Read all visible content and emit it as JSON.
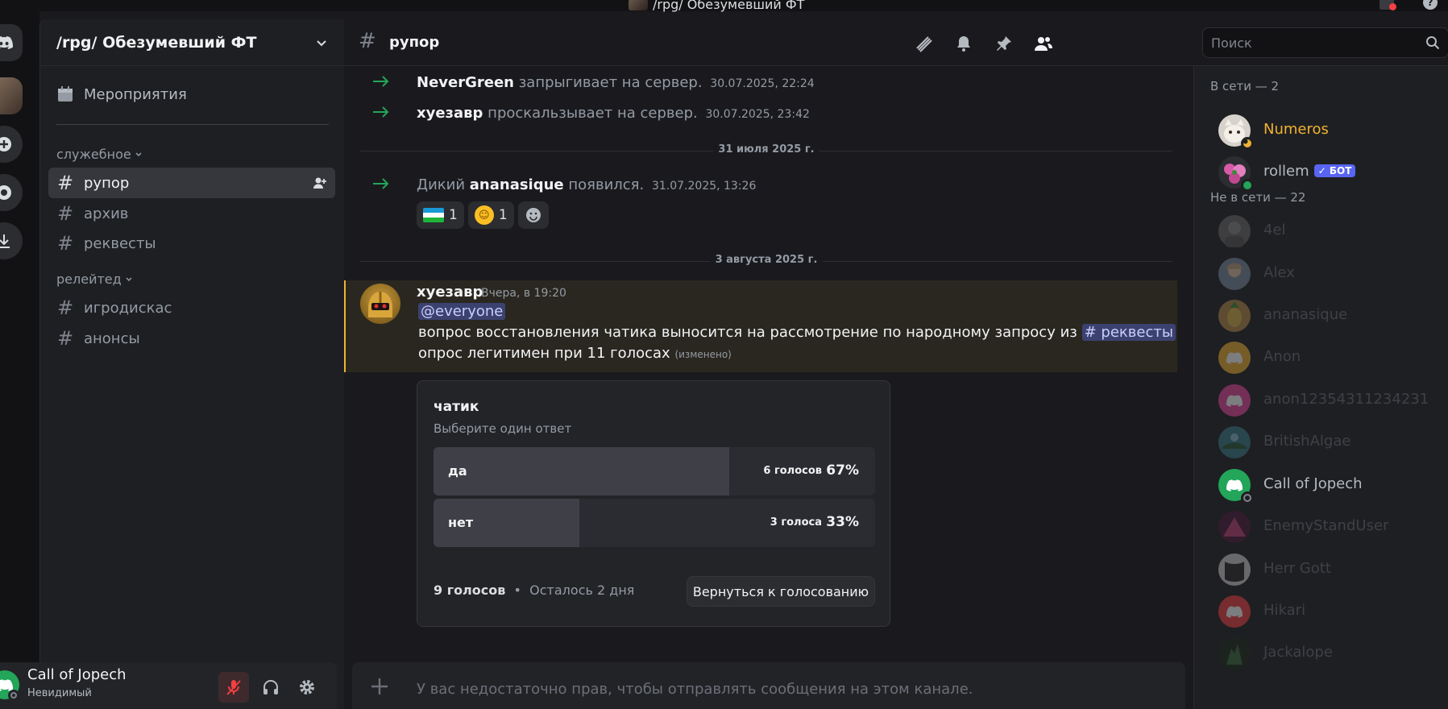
{
  "window": {
    "title": "/rpg/ Обезумевший ФТ",
    "help": "?"
  },
  "guild": {
    "name": "/rpg/ Обезумевший ФТ",
    "events_label": "Мероприятия",
    "categories": [
      {
        "name": "служебное",
        "channels": [
          "рупор",
          "архив",
          "реквесты"
        ]
      },
      {
        "name": "релейтед",
        "channels": [
          "игродискас",
          "анонсы"
        ]
      }
    ],
    "active_channel": "рупор"
  },
  "user": {
    "name": "Call of Jopech",
    "status": "Невидимый"
  },
  "header": {
    "channel": "рупор",
    "search_placeholder": "Поиск"
  },
  "messages": {
    "sys1": {
      "user": "NeverGreen",
      "action": "запрыгивает на сервер.",
      "ts": "30.07.2025, 22:24"
    },
    "sys2": {
      "user": "хуезавр",
      "action": "проскальзывает на сервер.",
      "ts": "30.07.2025, 23:42"
    },
    "date1": "31 июля 2025 г.",
    "sys3": {
      "prefix": "Дикий",
      "user": "ananasique",
      "action": "появился.",
      "ts": "31.07.2025, 13:26"
    },
    "reactions": [
      {
        "count": "1"
      },
      {
        "count": "1"
      }
    ],
    "date2": "3 августа 2025 г.",
    "main": {
      "author": "хуезавр",
      "ts": "Вчера, в 19:20",
      "mention": "@everyone",
      "line1": "вопрос восстановления чатика выносится на рассмотрение по народному запросу из",
      "line1_channel": "реквесты",
      "line2": "опрос легитимен при 11 голосах",
      "edited": "(изменено)"
    }
  },
  "poll": {
    "question": "чатик",
    "hint": "Выберите один ответ",
    "answers": [
      {
        "label": "да",
        "votes": "6 голосов",
        "percent": "67%",
        "fraction": 0.67
      },
      {
        "label": "нет",
        "votes": "3 голоса",
        "percent": "33%",
        "fraction": 0.33
      }
    ],
    "total": "9 голосов",
    "remaining": "Осталось 2 дня",
    "back_label": "Вернуться к голосованию"
  },
  "composer": {
    "placeholder": "У вас недостаточно прав, чтобы отправлять сообщения на этом канале."
  },
  "members": {
    "online_header": "В сети — 2",
    "online": [
      {
        "name": "Numeros",
        "color": "#f0b232"
      },
      {
        "name": "rollem",
        "badge": "БОТ"
      }
    ],
    "offline_header": "Не в сети — 22",
    "offline": [
      "4el",
      "Alex",
      "ananasique",
      "Anon",
      "anon12354311234231",
      "BritishAlgae",
      "Call of Jopech",
      "EnemyStandUser",
      "Herr Gott",
      "Hikari",
      "Jackalope"
    ]
  },
  "colors": {
    "accent": "#5865f2",
    "online": "#23a55a",
    "mention_bg": "#3c4270",
    "mention_border": "#f0b232"
  }
}
